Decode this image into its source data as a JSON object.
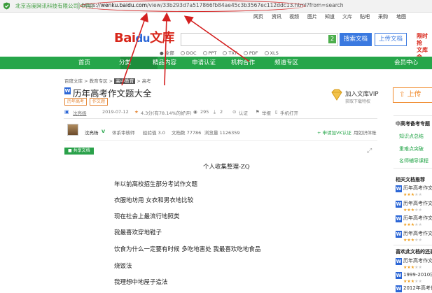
{
  "address_bar": {
    "site_name": "北京百度网讯科技有限公司[中国]",
    "url_prefix": "https://",
    "url_domain": "wenku.baidu.com",
    "url_rest": "/view/33b293d7a517866fb84ae45c3b3567ec112ddc13.html?from=search"
  },
  "top_nav": [
    "网页",
    "资讯",
    "视频",
    "图片",
    "知道",
    "文库",
    "贴吧",
    "采购",
    "地图"
  ],
  "logo": {
    "bai": "Bai",
    "paw": "du",
    "wenku": "文库"
  },
  "search": {
    "badge": "2",
    "search_button": "搜索文档",
    "upload_button": "上传文档",
    "promo_line1": "限时抢",
    "promo_line2": "文库会"
  },
  "filters": [
    "全部",
    "DOC",
    "PPT",
    "TXT",
    "PDF",
    "XLS"
  ],
  "green_nav": [
    "首页",
    "分类",
    "精品内容",
    "申请认证",
    "机构合作",
    "频道专区",
    "会员中心"
  ],
  "breadcrumb": [
    "百度文库",
    "教育专区",
    "高中教育",
    "高考"
  ],
  "doc": {
    "title": "历年高考作文题大全",
    "tags": [
      "历年高考",
      "作文题"
    ],
    "meta": {
      "author": "沈亮杨",
      "date": "2019-07-12",
      "rating": "4.3分(有78.14%的好评)",
      "views": "295",
      "downloads": "2",
      "certified": "认证",
      "report": "举报",
      "mobile": "手机打开"
    },
    "add_library": "加入文库VIP",
    "add_library_sub": "获取下载特权",
    "upload_label": "上传",
    "author_row": {
      "name": "沈亮杨",
      "badge": "V",
      "role": "体系审核师",
      "level": "经验值 3.0",
      "docs": "文档数 77786",
      "reads": "浏览量 1126359",
      "apply": "+ 申请加VK认证",
      "follow": "用如识体账"
    },
    "share_label": "共享文档",
    "heading": "个人收集整理-ZQ",
    "lines": [
      "年以前高校招生部分考试作文题",
      "衣服地坊用 女衣和男衣地比较",
      "现在社会上最流行地照类",
      "我最喜欢穿地鞋子",
      "饮食为什么一定要有时候 多吃地害处 我最喜欢吃地食品",
      "烧饭法",
      "我理想中地屋子造法"
    ]
  },
  "sidebar": {
    "section1": "中高考备考专题",
    "links": [
      "知识点总结",
      "重难点突破",
      "名师辅导课程"
    ],
    "section2": "相关文档推荐",
    "related": [
      "历年高考作文",
      "历年高考作文",
      "历年高考作文",
      "历年高考作文"
    ],
    "section3": "喜欢此文档的还喜",
    "liked": [
      "历年高考作文",
      "1999-2010语",
      "2012年高考作"
    ]
  },
  "colors": {
    "green": "#26a64a",
    "red": "#d42020",
    "blue": "#3a79e0",
    "orange": "#e5893a"
  }
}
